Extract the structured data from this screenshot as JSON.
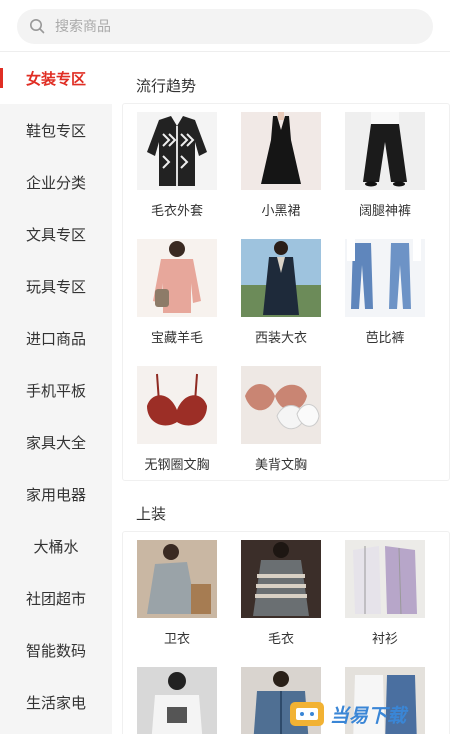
{
  "search": {
    "placeholder": "搜索商品"
  },
  "sidebar": {
    "items": [
      {
        "label": "女装专区"
      },
      {
        "label": "鞋包专区"
      },
      {
        "label": "企业分类"
      },
      {
        "label": "文具专区"
      },
      {
        "label": "玩具专区"
      },
      {
        "label": "进口商品"
      },
      {
        "label": "手机平板"
      },
      {
        "label": "家具大全"
      },
      {
        "label": "家用电器"
      },
      {
        "label": "大桶水"
      },
      {
        "label": "社团超市"
      },
      {
        "label": "智能数码"
      },
      {
        "label": "生活家电"
      }
    ],
    "active_index": 0
  },
  "sections": [
    {
      "title": "流行趋势",
      "items": [
        {
          "label": "毛衣外套"
        },
        {
          "label": "小黑裙"
        },
        {
          "label": "阔腿神裤"
        },
        {
          "label": "宝藏羊毛"
        },
        {
          "label": "西装大衣"
        },
        {
          "label": "芭比裤"
        },
        {
          "label": "无钢圈文胸"
        },
        {
          "label": "美背文胸"
        }
      ]
    },
    {
      "title": "上装",
      "items": [
        {
          "label": "卫衣"
        },
        {
          "label": "毛衣"
        },
        {
          "label": "衬衫"
        },
        {
          "label": ""
        },
        {
          "label": ""
        },
        {
          "label": ""
        }
      ]
    }
  ],
  "watermark": {
    "text": "当易下载"
  },
  "colors": {
    "accent": "#e02e24",
    "sidebar_bg": "#f5f5f5"
  }
}
